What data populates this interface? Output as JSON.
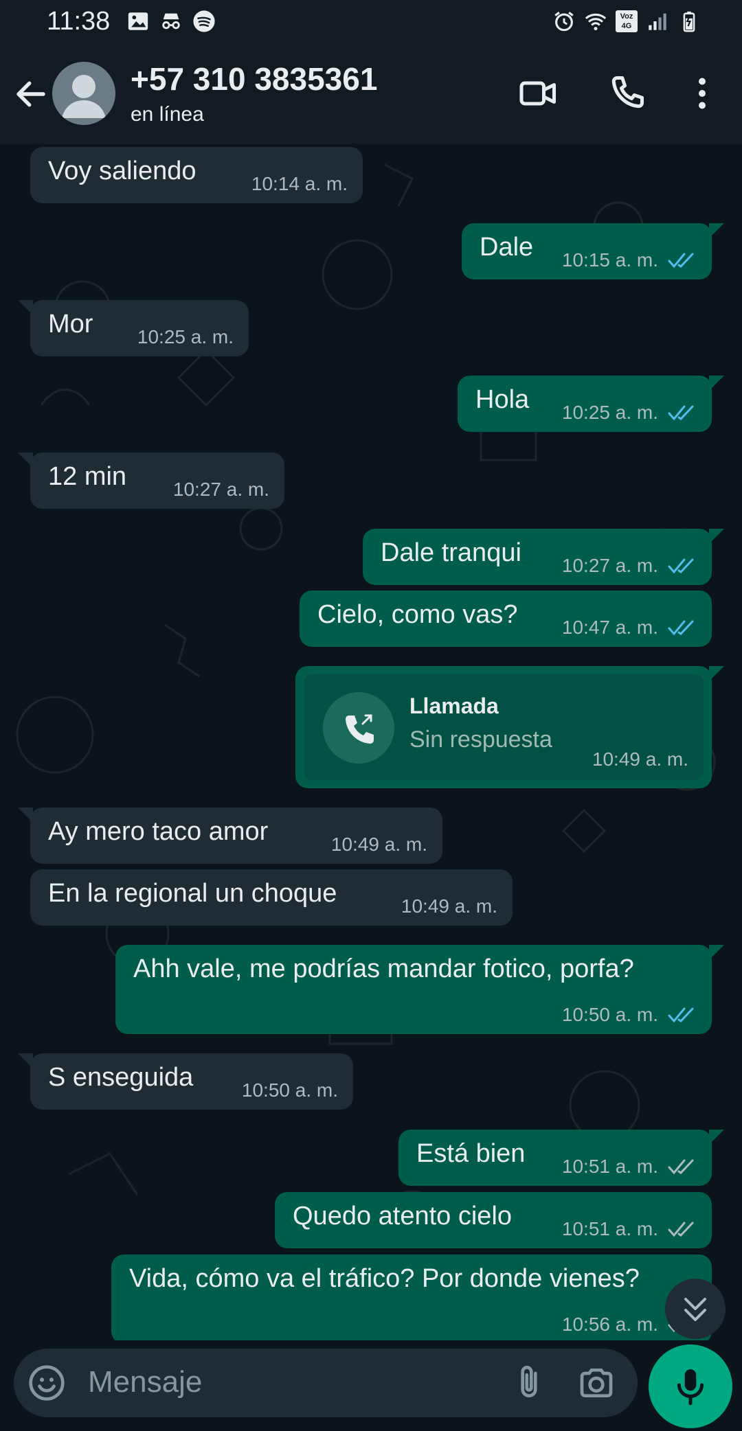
{
  "status_bar": {
    "time": "11:38",
    "left_icons": [
      "gallery-icon",
      "incognito-icon",
      "spotify-icon"
    ],
    "right_icons": [
      "alarm-icon",
      "wifi-icon",
      "volte-icon",
      "signal-icon",
      "battery-icon"
    ],
    "volte_label": "Voz 4G"
  },
  "header": {
    "contact_name": "+57 310 3835361",
    "contact_status": "en línea"
  },
  "messages": [
    {
      "dir": "in",
      "text": "Voy saliendo",
      "time": "10:14 a. m."
    },
    {
      "dir": "out",
      "text": "Dale",
      "time": "10:15 a. m.",
      "read": true
    },
    {
      "dir": "in",
      "text": "Mor",
      "time": "10:25 a. m."
    },
    {
      "dir": "out",
      "text": "Hola",
      "time": "10:25 a. m.",
      "read": true
    },
    {
      "dir": "in",
      "text": "12 min",
      "time": "10:27 a. m."
    },
    {
      "dir": "out",
      "text": "Dale tranqui",
      "time": "10:27 a. m.",
      "read": true
    },
    {
      "dir": "out",
      "text": "Cielo, como vas?",
      "time": "10:47 a. m.",
      "read": true
    },
    {
      "dir": "out",
      "type": "call",
      "title": "Llamada",
      "subtitle": "Sin respuesta",
      "time": "10:49 a. m."
    },
    {
      "dir": "in",
      "text": "Ay mero taco amor",
      "time": "10:49 a. m."
    },
    {
      "dir": "in",
      "text": "En la regional un choque",
      "time": "10:49 a. m."
    },
    {
      "dir": "out",
      "text": "Ahh vale, me podrías mandar fotico, porfa?",
      "time": "10:50 a. m.",
      "read": true
    },
    {
      "dir": "in",
      "text": "S enseguida",
      "time": "10:50 a. m."
    },
    {
      "dir": "out",
      "text": "Está bien",
      "time": "10:51 a. m.",
      "read": false
    },
    {
      "dir": "out",
      "text": "Quedo atento cielo",
      "time": "10:51 a. m.",
      "read": false
    },
    {
      "dir": "out",
      "text": "Vida, cómo va el tráfico? Por donde vienes?",
      "time": "10:56 a. m.",
      "read": false
    }
  ],
  "input": {
    "placeholder": "Mensaje"
  },
  "colors": {
    "incoming_bubble": "#1f2c34",
    "outgoing_bubble": "#005c4b",
    "read_ticks": "#53bdeb",
    "unread_ticks": "#aebac1",
    "accent": "#00a884"
  }
}
